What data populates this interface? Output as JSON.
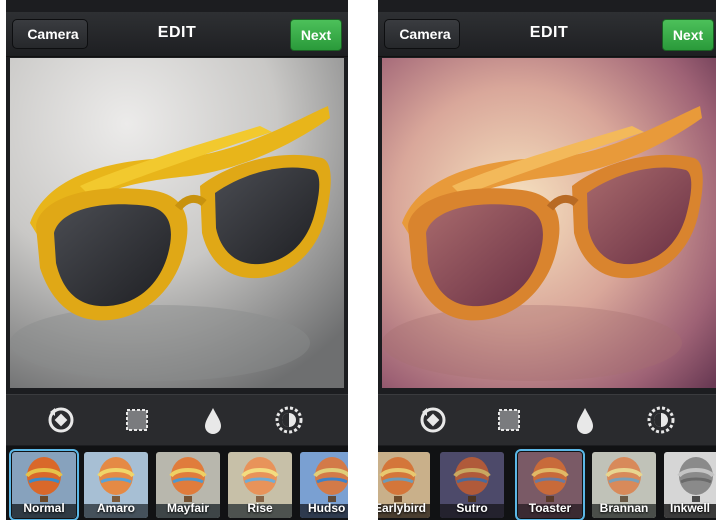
{
  "left": {
    "header": {
      "back_label": "Camera",
      "title": "EDIT",
      "next_label": "Next"
    },
    "filters": [
      {
        "label": "Normal",
        "selected": true
      },
      {
        "label": "Amaro",
        "selected": false
      },
      {
        "label": "Mayfair",
        "selected": false
      },
      {
        "label": "Rise",
        "selected": false
      },
      {
        "label": "Hudso",
        "selected": false
      }
    ]
  },
  "right": {
    "header": {
      "back_label": "Camera",
      "title": "EDIT",
      "next_label": "Next"
    },
    "filters": [
      {
        "label": "Earlybird",
        "selected": false
      },
      {
        "label": "Sutro",
        "selected": false
      },
      {
        "label": "Toaster",
        "selected": true
      },
      {
        "label": "Brannan",
        "selected": false
      },
      {
        "label": "Inkwell",
        "selected": false
      }
    ]
  },
  "tools": [
    "rotate-icon",
    "border-frame-icon",
    "drop-blur-icon",
    "lux-sun-icon"
  ],
  "colors": {
    "next_green": "#2a9a3a",
    "selection_blue": "#5bb7e6",
    "glasses_yellow": "#e8b51a"
  }
}
